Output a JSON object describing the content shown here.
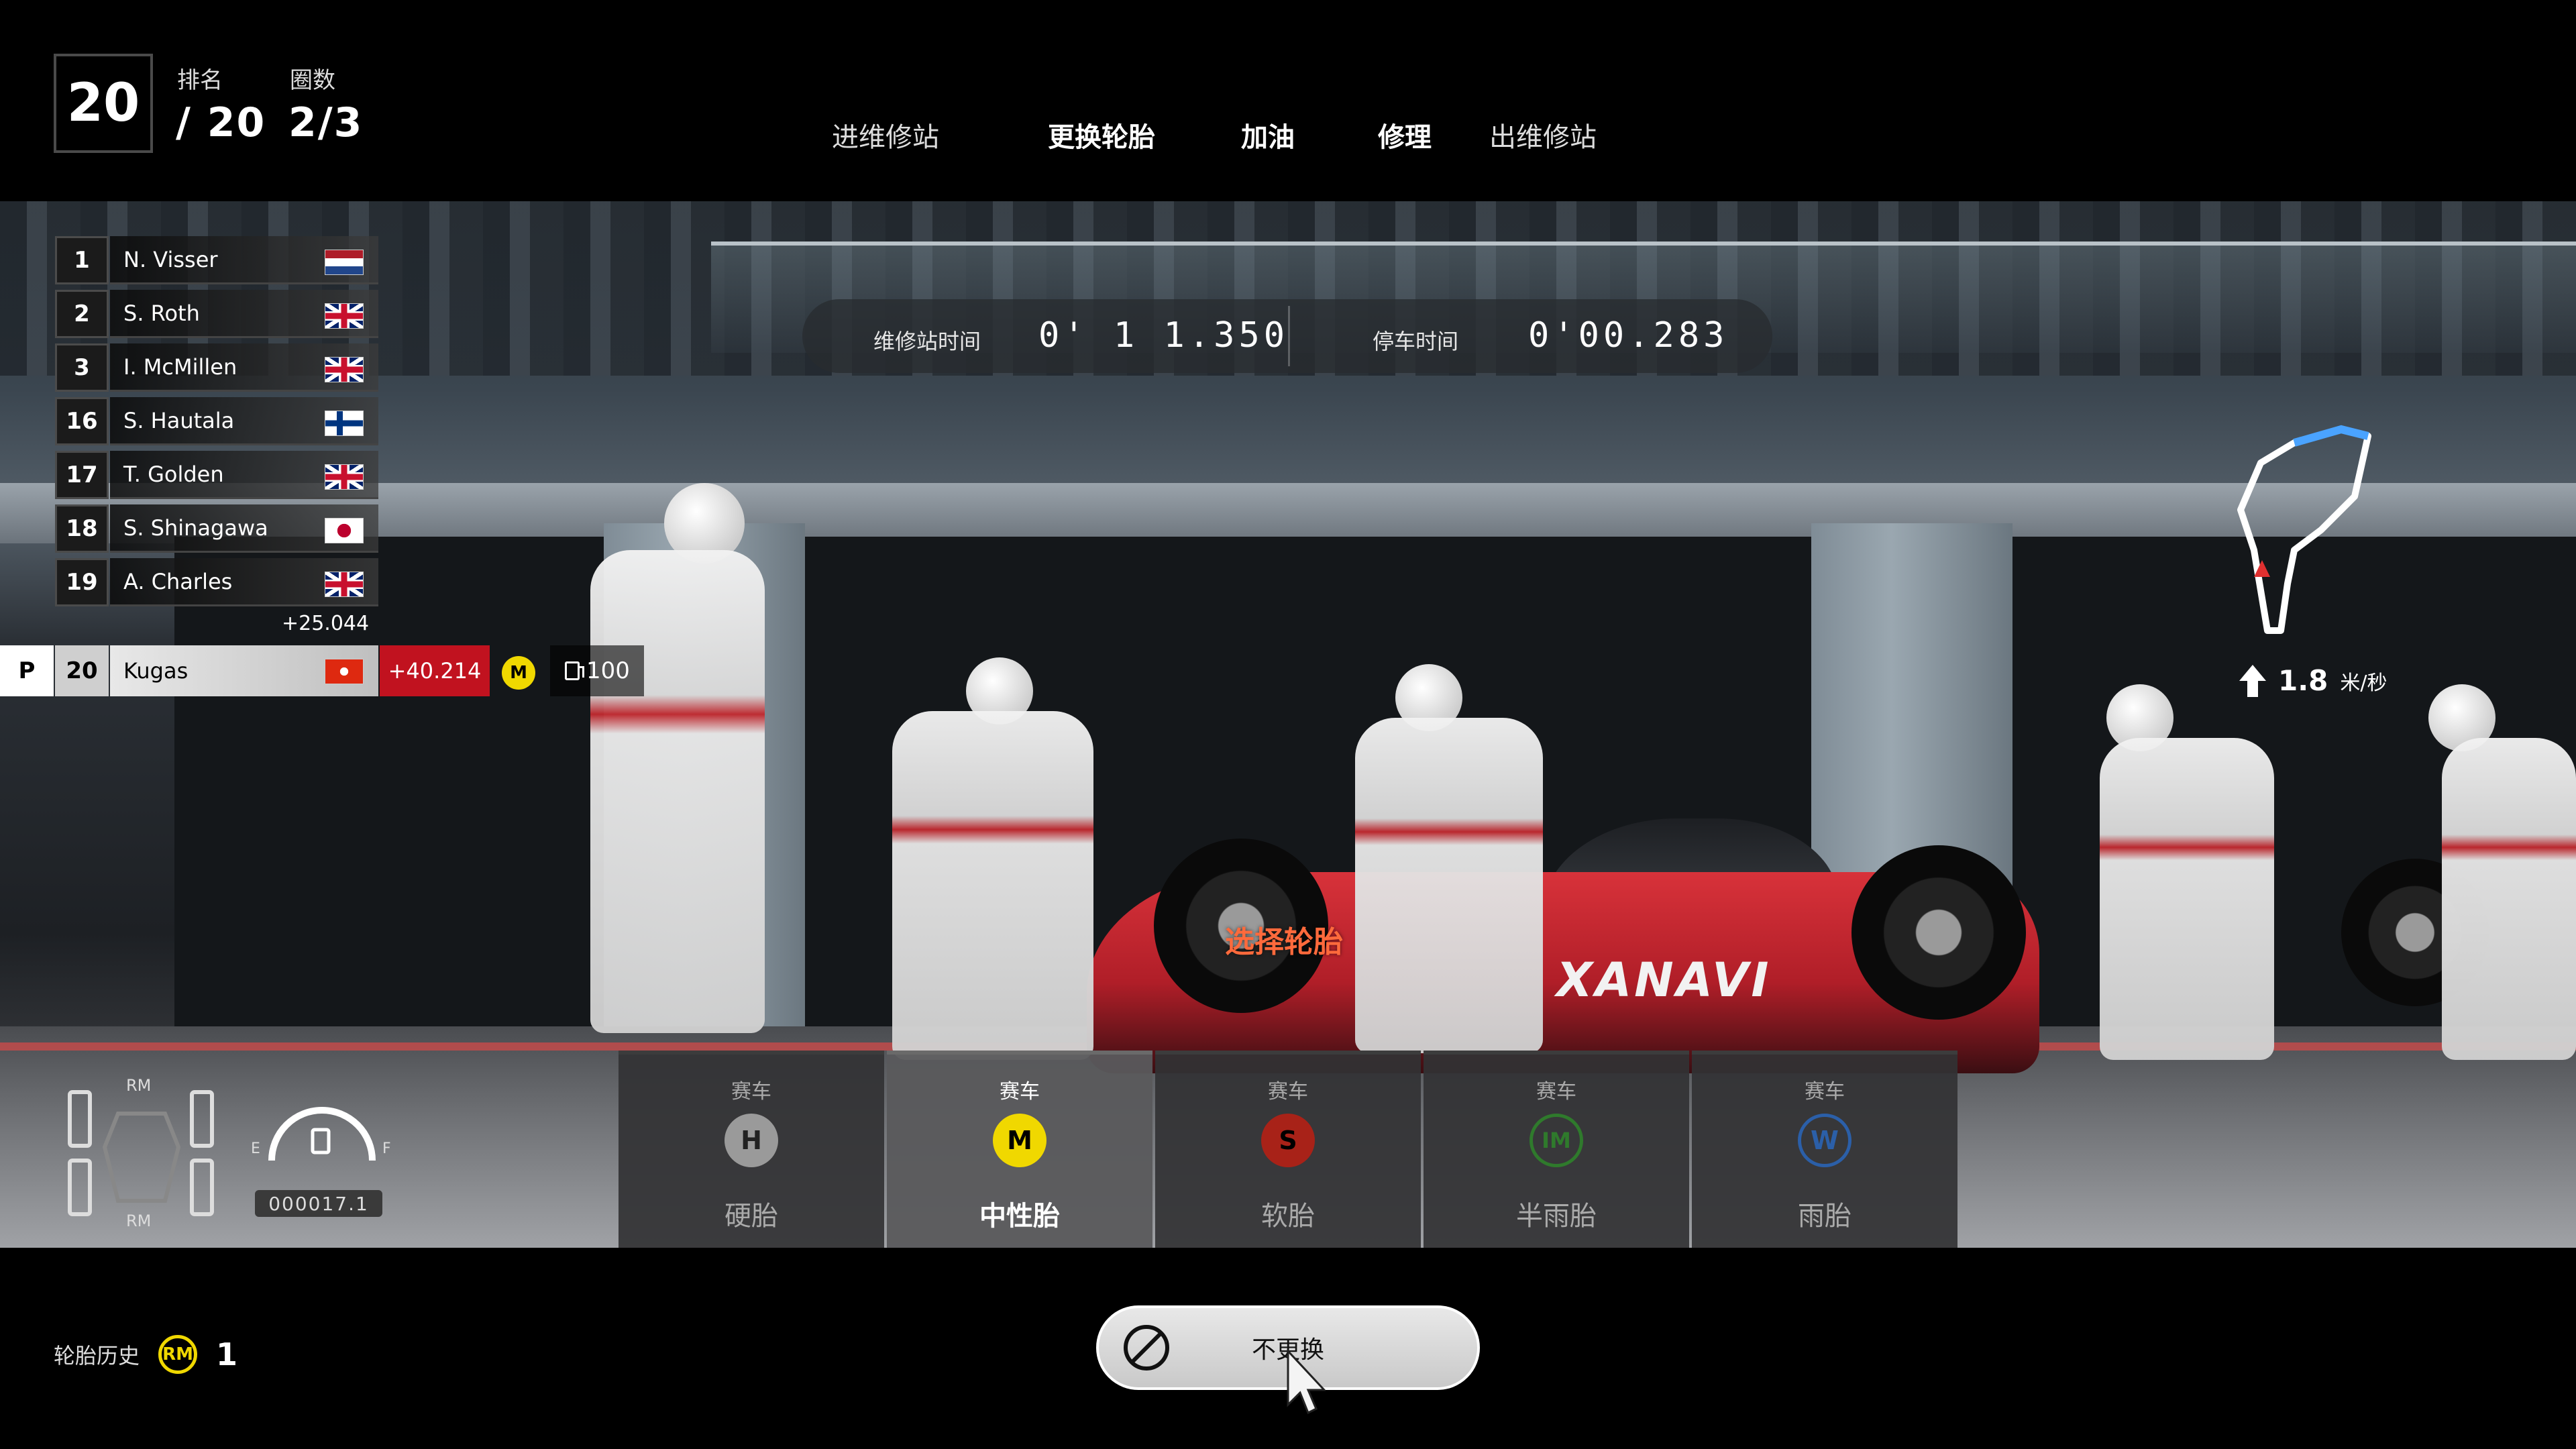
{
  "top": {
    "position": "20",
    "rank_label": "排名",
    "rank_value": "/ 20",
    "laps_label": "圈数",
    "laps_value": "2/3",
    "menu": [
      {
        "label": "进维修站",
        "active": false
      },
      {
        "label": "更换轮胎",
        "active": true
      },
      {
        "label": "加油",
        "active": true
      },
      {
        "label": "修理",
        "active": true
      },
      {
        "label": "出维修站",
        "active": false
      }
    ]
  },
  "pit_timer": {
    "pit_time_label": "维修站时间",
    "pit_time_value": "0' 1 1.350",
    "stop_time_label": "停车时间",
    "stop_time_value": "0'00.283"
  },
  "standings": [
    {
      "pos": "1",
      "name": "N. Visser",
      "flag": "nl"
    },
    {
      "pos": "2",
      "name": "S. Roth",
      "flag": "uk"
    },
    {
      "pos": "3",
      "name": "I. McMillen",
      "flag": "uk"
    },
    {
      "pos": "16",
      "name": "S. Hautala",
      "flag": "fi"
    },
    {
      "pos": "17",
      "name": "T. Golden",
      "flag": "uk"
    },
    {
      "pos": "18",
      "name": "S. Shinagawa",
      "flag": "jp"
    },
    {
      "pos": "19",
      "name": "A. Charles",
      "flag": "uk"
    }
  ],
  "gap_ahead": "+25.044",
  "player": {
    "p_label": "P",
    "pos": "20",
    "name": "Kugas",
    "flag": "hk",
    "gap": "+40.214",
    "tyre": "M",
    "fuel": "100"
  },
  "speed": {
    "value": "1.8",
    "unit": "米/秒"
  },
  "scene_label": "选择轮胎",
  "scene_car_logo": "XANAVI",
  "car_status": {
    "front_label": "RM",
    "rear_label": "RM",
    "fuel_e": "E",
    "fuel_f": "F",
    "odometer": "000017.1"
  },
  "tyres": [
    {
      "category": "赛车",
      "code": "H",
      "name": "硬胎",
      "color": "#9a9a9a",
      "text_color": "#222",
      "style": "filled",
      "selected": false
    },
    {
      "category": "赛车",
      "code": "M",
      "name": "中性胎",
      "color": "#f0d800",
      "text_color": "#000",
      "style": "filled",
      "selected": true
    },
    {
      "category": "赛车",
      "code": "S",
      "name": "软胎",
      "color": "#a82218",
      "text_color": "#000",
      "style": "filled",
      "selected": false
    },
    {
      "category": "赛车",
      "code": "IM",
      "name": "半雨胎",
      "color": "#2f7a2c",
      "text_color": "#2f7a2c",
      "style": "ring",
      "selected": false
    },
    {
      "category": "赛车",
      "code": "W",
      "name": "雨胎",
      "color": "#2b5fa8",
      "text_color": "#2b5fa8",
      "style": "ring",
      "selected": false
    }
  ],
  "tyre_history": {
    "label": "轮胎历史",
    "badge": "RM",
    "count": "1"
  },
  "no_change_label": "不更换"
}
